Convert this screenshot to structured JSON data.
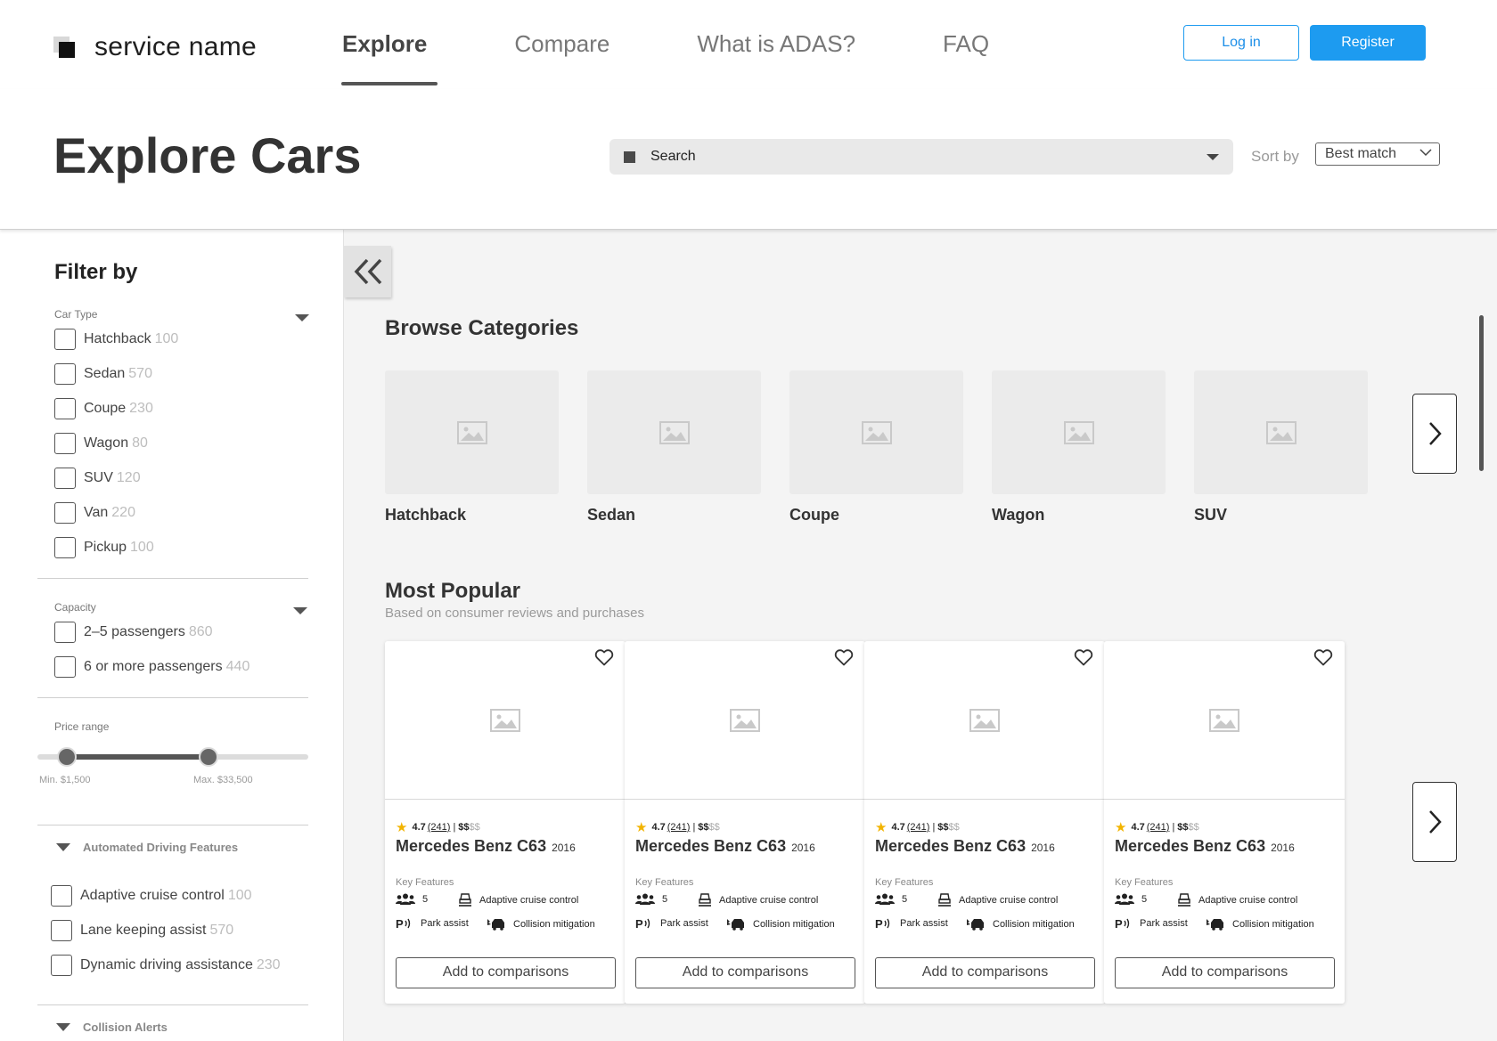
{
  "brand": {
    "name": "service name"
  },
  "nav": [
    {
      "label": "Explore",
      "active": true
    },
    {
      "label": "Compare",
      "active": false
    },
    {
      "label": "What is ADAS?",
      "active": false
    },
    {
      "label": "FAQ",
      "active": false
    }
  ],
  "auth": {
    "login_label": "Log in",
    "register_label": "Register"
  },
  "colors": {
    "accent": "#1d9bf0",
    "star": "#f2b400"
  },
  "page": {
    "title": "Explore Cars"
  },
  "search": {
    "placeholder": "Search"
  },
  "sort": {
    "label": "Sort by",
    "value": "Best match"
  },
  "filters": {
    "title": "Filter by",
    "car_type": {
      "label": "Car Type",
      "options": [
        {
          "label": "Hatchback",
          "count": "100"
        },
        {
          "label": "Sedan",
          "count": "570"
        },
        {
          "label": "Coupe",
          "count": "230"
        },
        {
          "label": "Wagon",
          "count": "80"
        },
        {
          "label": "SUV",
          "count": "120"
        },
        {
          "label": "Van",
          "count": "220"
        },
        {
          "label": "Pickup",
          "count": "100"
        }
      ]
    },
    "capacity": {
      "label": "Capacity",
      "options": [
        {
          "label": "2–5 passengers",
          "count": "860"
        },
        {
          "label": "6 or more passengers",
          "count": "440"
        }
      ]
    },
    "price": {
      "label": "Price range",
      "min_label": "Min. $1,500",
      "max_label": "Max. $33,500",
      "min_fraction": 0.11,
      "max_fraction": 0.63
    },
    "automated": {
      "label": "Automated Driving Features",
      "options": [
        {
          "label": "Adaptive cruise control",
          "count": "100"
        },
        {
          "label": "Lane keeping assist",
          "count": "570"
        },
        {
          "label": "Dynamic driving assistance",
          "count": "230"
        }
      ]
    },
    "collision": {
      "label": "Collision Alerts"
    }
  },
  "categories": {
    "title": "Browse Categories",
    "items": [
      "Hatchback",
      "Sedan",
      "Coupe",
      "Wagon",
      "SUV"
    ]
  },
  "popular": {
    "title": "Most Popular",
    "subtitle": "Based on consumer reviews and purchases",
    "key_features_label": "Key Features",
    "add_label": "Add to comparisons",
    "cars": [
      {
        "rating": "4.7",
        "reviews": "(241)",
        "sep": "|",
        "price_dark": "$$",
        "price_light": "$$",
        "name": "Mercedes Benz C63",
        "year": "2016",
        "seats": "5",
        "f1": "Adaptive cruise control",
        "f2": "Park assist",
        "f3": "Collision mitigation"
      },
      {
        "rating": "4.7",
        "reviews": "(241)",
        "sep": "|",
        "price_dark": "$$",
        "price_light": "$$",
        "name": "Mercedes Benz C63",
        "year": "2016",
        "seats": "5",
        "f1": "Adaptive cruise control",
        "f2": "Park assist",
        "f3": "Collision mitigation"
      },
      {
        "rating": "4.7",
        "reviews": "(241)",
        "sep": "|",
        "price_dark": "$$",
        "price_light": "$$",
        "name": "Mercedes Benz C63",
        "year": "2016",
        "seats": "5",
        "f1": "Adaptive cruise control",
        "f2": "Park assist",
        "f3": "Collision mitigation"
      },
      {
        "rating": "4.7",
        "reviews": "(241)",
        "sep": "|",
        "price_dark": "$$",
        "price_light": "$$",
        "name": "Mercedes Benz C63",
        "year": "2016",
        "seats": "5",
        "f1": "Adaptive cruise control",
        "f2": "Park assist",
        "f3": "Collision mitigation"
      }
    ]
  }
}
